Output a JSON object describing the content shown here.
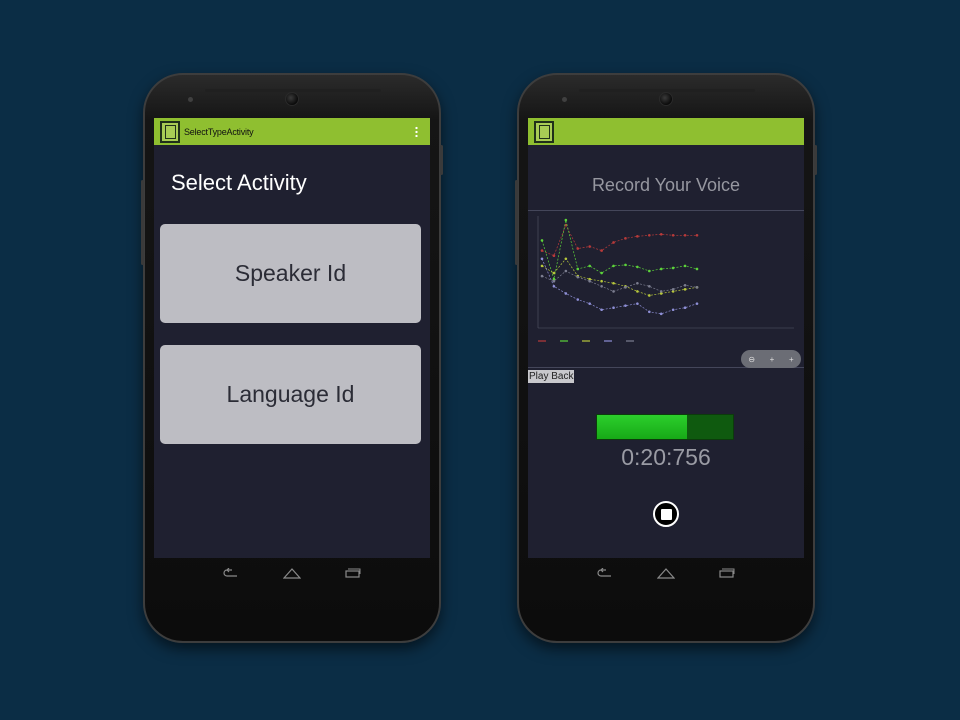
{
  "left_phone": {
    "action_bar_title": "SelectTypeActivity",
    "heading": "Select  Activity",
    "buttons": [
      {
        "label": "Speaker Id"
      },
      {
        "label": "Language Id"
      }
    ]
  },
  "right_phone": {
    "heading": "Record Your Voice",
    "playback_label": "Play Back",
    "timer": "0:20:756",
    "progress_fraction": 0.66,
    "zoom_controls": [
      "⊖",
      "+",
      "+"
    ]
  },
  "nav_icons": [
    "back-icon",
    "home-icon",
    "recents-icon"
  ],
  "colors": {
    "background": "#0b2d45",
    "action_bar": "#8fbf30",
    "screen": "#1f2030",
    "button": "#bdbdc3",
    "progress_fill": "#22c022"
  },
  "chart_data": {
    "type": "line",
    "series": [
      {
        "color": "#b83a3a",
        "values": [
          0.7,
          0.65,
          0.95,
          0.72,
          0.74,
          0.7,
          0.78,
          0.82,
          0.84,
          0.85,
          0.86,
          0.85,
          0.85,
          0.85
        ]
      },
      {
        "color": "#5cd33a",
        "values": [
          0.8,
          0.42,
          1.0,
          0.52,
          0.55,
          0.48,
          0.55,
          0.56,
          0.54,
          0.5,
          0.52,
          0.53,
          0.55,
          0.52
        ]
      },
      {
        "color": "#b7c73c",
        "values": [
          0.55,
          0.48,
          0.62,
          0.45,
          0.42,
          0.4,
          0.38,
          0.35,
          0.3,
          0.26,
          0.28,
          0.3,
          0.32,
          0.34
        ]
      },
      {
        "color": "#8e8fd6",
        "values": [
          0.62,
          0.35,
          0.28,
          0.22,
          0.18,
          0.12,
          0.14,
          0.16,
          0.18,
          0.1,
          0.08,
          0.12,
          0.14,
          0.18
        ]
      },
      {
        "color": "#7c7e90",
        "values": [
          0.45,
          0.4,
          0.5,
          0.44,
          0.4,
          0.35,
          0.3,
          0.34,
          0.38,
          0.35,
          0.3,
          0.32,
          0.36,
          0.34
        ]
      }
    ]
  }
}
